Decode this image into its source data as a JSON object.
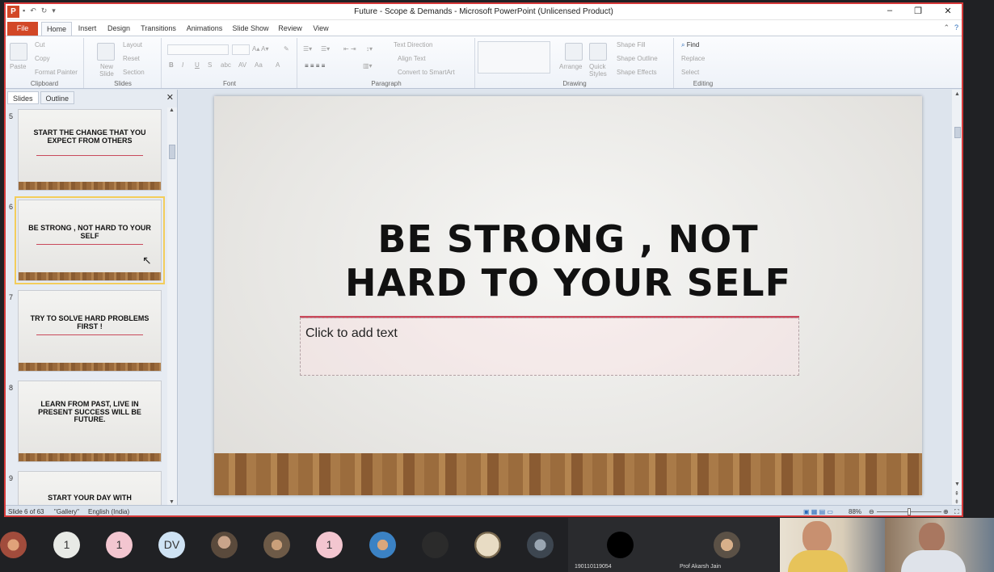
{
  "window": {
    "title": "Future - Scope & Demands  -  Microsoft PowerPoint (Unlicensed Product)"
  },
  "tabs": [
    "File",
    "Home",
    "Insert",
    "Design",
    "Transitions",
    "Animations",
    "Slide Show",
    "Review",
    "View"
  ],
  "ribbon": {
    "clipboard": {
      "label": "Clipboard",
      "paste": "Paste",
      "cut": "Cut",
      "copy": "Copy",
      "format_painter": "Format Painter"
    },
    "slides": {
      "label": "Slides",
      "new_slide": "New Slide",
      "layout": "Layout",
      "reset": "Reset",
      "section": "Section"
    },
    "font": {
      "label": "Font"
    },
    "paragraph": {
      "label": "Paragraph",
      "text_direction": "Text Direction",
      "align_text": "Align Text",
      "convert": "Convert to SmartArt"
    },
    "drawing": {
      "label": "Drawing",
      "arrange": "Arrange",
      "quick_styles": "Quick Styles",
      "shape_fill": "Shape Fill",
      "shape_outline": "Shape Outline",
      "shape_effects": "Shape Effects"
    },
    "editing": {
      "label": "Editing",
      "find": "Find",
      "replace": "Replace",
      "select": "Select"
    }
  },
  "panel": {
    "tabs": [
      "Slides",
      "Outline"
    ]
  },
  "thumbnails": [
    {
      "num": "5",
      "title": "START THE CHANGE THAT YOU EXPECT FROM OTHERS",
      "selected": false
    },
    {
      "num": "6",
      "title": "BE STRONG , NOT HARD TO YOUR SELF",
      "selected": true
    },
    {
      "num": "7",
      "title": "TRY TO SOLVE HARD PROBLEMS FIRST !",
      "selected": false
    },
    {
      "num": "8",
      "title": "LEARN FROM PAST, LIVE IN PRESENT SUCCESS WILL BE FUTURE.",
      "selected": false
    },
    {
      "num": "9",
      "title": "START YOUR DAY WITH",
      "selected": false
    }
  ],
  "slide": {
    "title_line1": "BE STRONG , NOT",
    "title_line2": "HARD TO YOUR SELF",
    "subtitle_placeholder": "Click to add text"
  },
  "status": {
    "slide_info": "Slide 6 of 63",
    "theme": "\"Gallery\"",
    "language": "English (India)",
    "zoom": "88%"
  },
  "meeting": {
    "participants": [
      {
        "initials": "1"
      },
      {
        "initials": "1"
      },
      {
        "initials": "DV"
      },
      {
        "initials": "1"
      }
    ],
    "names": {
      "p1": "190110119054",
      "p2": "Prof Akarsh Jain"
    }
  },
  "colors": {
    "file_tab": "#d24726",
    "window_border": "#d63a3a",
    "accent_line": "#c94a5c",
    "selection": "#f3cd5b"
  }
}
